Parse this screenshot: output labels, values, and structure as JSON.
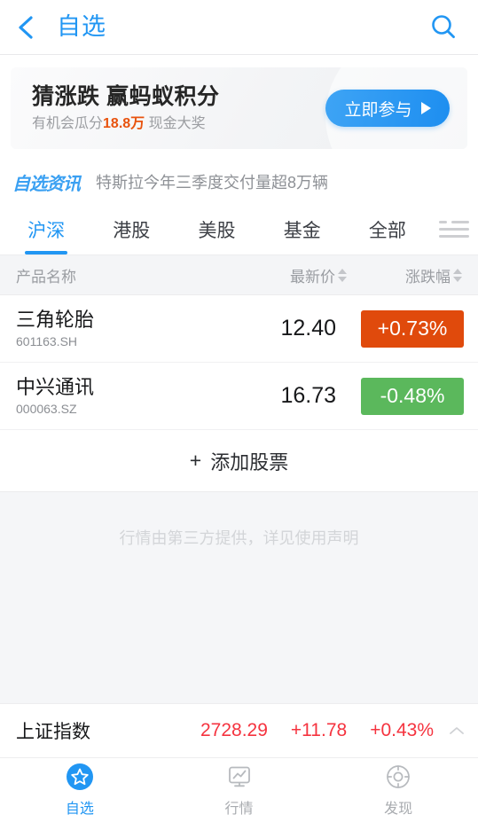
{
  "header": {
    "title": "自选",
    "back_icon": "chevron-left-icon",
    "search_icon": "search-icon"
  },
  "banner": {
    "title": "猜涨跌 赢蚂蚁积分",
    "sub_prefix": "有机会瓜分",
    "sub_highlight": "18.8万",
    "sub_suffix": "现金大奖",
    "button_label": "立即参与",
    "button_arrow": "play-arrow-icon",
    "highlight_color": "#e8530e",
    "button_color": "#1d8ef0"
  },
  "news": {
    "logo": "自选资讯",
    "headline": "特斯拉今年三季度交付量超8万辆"
  },
  "tabs": {
    "items": [
      {
        "label": "沪深",
        "active": true
      },
      {
        "label": "港股",
        "active": false
      },
      {
        "label": "美股",
        "active": false
      },
      {
        "label": "基金",
        "active": false
      },
      {
        "label": "全部",
        "active": false
      }
    ],
    "menu_icon": "hamburger-menu-icon",
    "active_color": "#2196f3"
  },
  "table": {
    "columns": {
      "name": "产品名称",
      "price": "最新价",
      "change": "涨跌幅"
    },
    "rows": [
      {
        "name": "三角轮胎",
        "code": "601163.SH",
        "price": "12.40",
        "change": "+0.73%",
        "direction": "up",
        "badge_color": "#e04a0c"
      },
      {
        "name": "中兴通讯",
        "code": "000063.SZ",
        "price": "16.73",
        "change": "-0.48%",
        "direction": "down",
        "badge_color": "#5bb85c"
      }
    ],
    "add_label": "添加股票",
    "add_plus": "+"
  },
  "disclaimer": "行情由第三方提供，详见使用声明",
  "index_bar": {
    "name": "上证指数",
    "value": "2728.29",
    "change": "+11.78",
    "percent": "+0.43%",
    "color": "#f5333f",
    "chevron_icon": "chevron-up-icon"
  },
  "bottom_nav": {
    "items": [
      {
        "label": "自选",
        "icon": "star-filled-circle-icon",
        "active": true
      },
      {
        "label": "行情",
        "icon": "monitor-chart-icon",
        "active": false
      },
      {
        "label": "发现",
        "icon": "compass-target-icon",
        "active": false
      }
    ]
  }
}
